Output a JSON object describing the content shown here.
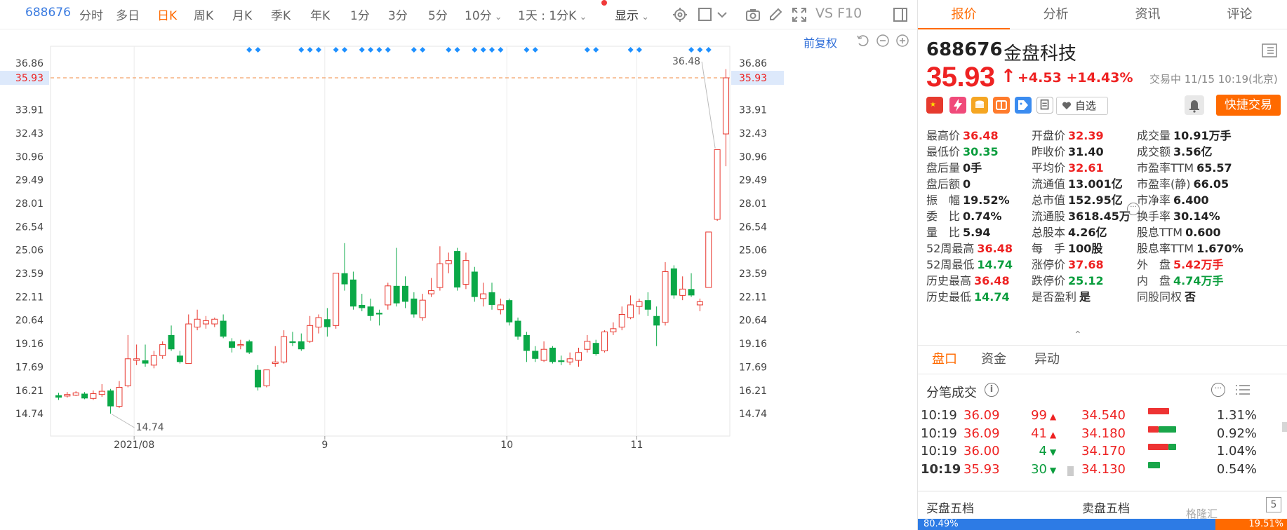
{
  "toolbar": {
    "code": "688676",
    "periods": [
      "分时",
      "多日",
      "日K",
      "周K",
      "月K",
      "季K",
      "年K",
      "1分",
      "3分",
      "5分",
      "10分"
    ],
    "active_period": "日K",
    "interval_select": "1天 : 1分K",
    "display_select": "显示",
    "f10_label": "VS F10",
    "adjust_label": "前复权"
  },
  "tabs": [
    "报价",
    "分析",
    "资讯",
    "评论"
  ],
  "active_tab": "报价",
  "stock": {
    "code": "688676",
    "name": "金盘科技",
    "price": "35.93",
    "change": "+4.53",
    "change_pct": "+14.43%",
    "status": "交易中 11/15 10:19(北京)",
    "watch_label": "自选",
    "quick_trade": "快捷交易"
  },
  "stats": [
    [
      {
        "label": "最高价",
        "value": "36.48",
        "color": "red"
      },
      {
        "label": "开盘价",
        "value": "32.39",
        "color": "red"
      },
      {
        "label": "成交量",
        "value": "10.91万手",
        "color": "black"
      }
    ],
    [
      {
        "label": "最低价",
        "value": "30.35",
        "color": "green"
      },
      {
        "label": "昨收价",
        "value": "31.40",
        "color": "black"
      },
      {
        "label": "成交额",
        "value": "3.56亿",
        "color": "black"
      }
    ],
    [
      {
        "label": "盘后量",
        "value": "0手",
        "color": "black"
      },
      {
        "label": "平均价",
        "value": "32.61",
        "color": "red"
      },
      {
        "label": "市盈率TTM",
        "value": "65.57",
        "color": "black"
      }
    ],
    [
      {
        "label": "盘后额",
        "value": "0",
        "color": "black"
      },
      {
        "label": "流通值",
        "value": "13.001亿",
        "color": "black"
      },
      {
        "label": "市盈率(静)",
        "value": "66.05",
        "color": "black"
      }
    ],
    [
      {
        "label": "振　幅",
        "value": "19.52%",
        "color": "black"
      },
      {
        "label": "总市值",
        "value": "152.95亿",
        "color": "black"
      },
      {
        "label": "市净率",
        "value": "6.400",
        "color": "black"
      }
    ],
    [
      {
        "label": "委　比",
        "value": "0.74%",
        "color": "black"
      },
      {
        "label": "流通股",
        "value": "3618.45万",
        "color": "black"
      },
      {
        "label": "换手率",
        "value": "30.14%",
        "color": "black"
      }
    ],
    [
      {
        "label": "量　比",
        "value": "5.94",
        "color": "black"
      },
      {
        "label": "总股本",
        "value": "4.26亿",
        "color": "black"
      },
      {
        "label": "股息TTM",
        "value": "0.600",
        "color": "black"
      }
    ],
    [
      {
        "label": "52周最高",
        "value": "36.48",
        "color": "red"
      },
      {
        "label": "每　手",
        "value": "100股",
        "color": "black"
      },
      {
        "label": "股息率TTM",
        "value": "1.670%",
        "color": "black"
      }
    ],
    [
      {
        "label": "52周最低",
        "value": "14.74",
        "color": "green"
      },
      {
        "label": "涨停价",
        "value": "37.68",
        "color": "red"
      },
      {
        "label": "外　盘",
        "value": "5.42万手",
        "color": "red"
      }
    ],
    [
      {
        "label": "历史最高",
        "value": "36.48",
        "color": "red"
      },
      {
        "label": "跌停价",
        "value": "25.12",
        "color": "green"
      },
      {
        "label": "内　盘",
        "value": "4.74万手",
        "color": "green"
      }
    ],
    [
      {
        "label": "历史最低",
        "value": "14.74",
        "color": "green"
      },
      {
        "label": "是否盈利",
        "value": "是",
        "color": "black"
      },
      {
        "label": "同股同权",
        "value": "否",
        "color": "black"
      }
    ]
  ],
  "sub_tabs": [
    "盘口",
    "资金",
    "异动"
  ],
  "active_sub_tab": "盘口",
  "tick_title": "分笔成交",
  "ticks": [
    {
      "time": "10:19",
      "price": "36.09",
      "vol": "99",
      "dir": "up",
      "ref": "34.540",
      "pct": "1.31%",
      "red": 0.75,
      "green": 0.0
    },
    {
      "time": "10:19",
      "price": "36.09",
      "vol": "41",
      "dir": "up",
      "ref": "34.180",
      "pct": "0.92%",
      "red": 0.38,
      "green": 0.62
    },
    {
      "time": "10:19",
      "price": "36.00",
      "vol": "4",
      "dir": "down",
      "ref": "34.170",
      "pct": "1.04%",
      "red": 0.72,
      "green": 0.28
    },
    {
      "time": "10:19",
      "price": "35.93",
      "vol": "30",
      "dir": "down",
      "ref": "34.130",
      "pct": "0.54%",
      "red": 0.0,
      "green": 0.42
    }
  ],
  "orderbook": {
    "buy_label": "买盘五档",
    "sell_label": "卖盘五档",
    "five_label": "5",
    "buy_ratio": "80.49%",
    "sell_ratio": "19.51%"
  },
  "watermark": "格隆汇",
  "chart_data": {
    "type": "candlestick",
    "y_ticks": [
      "36.86",
      "35.93",
      "33.91",
      "32.43",
      "30.96",
      "29.49",
      "28.01",
      "26.54",
      "25.06",
      "23.59",
      "22.11",
      "20.64",
      "19.16",
      "17.69",
      "16.21",
      "14.74"
    ],
    "ylim": [
      14.74,
      36.86
    ],
    "x_labels": [
      {
        "label": "2021/08",
        "index": 9
      },
      {
        "label": "9",
        "index": 31
      },
      {
        "label": "10",
        "index": 52
      },
      {
        "label": "11",
        "index": 67
      }
    ],
    "current_price": 35.93,
    "high_annotation": {
      "label": "36.48",
      "index": 76
    },
    "low_annotation": {
      "label": "14.74",
      "index": 6
    },
    "event_marker_indices": [
      22,
      23,
      28,
      29,
      30,
      32,
      33,
      35,
      36,
      37,
      38,
      41,
      42,
      45,
      46,
      48,
      49,
      50,
      51,
      54,
      55,
      61,
      62,
      66,
      67,
      73,
      74,
      75
    ],
    "candles": [
      {
        "o": 15.9,
        "c": 15.75,
        "h": 16.05,
        "l": 15.6
      },
      {
        "o": 15.85,
        "c": 15.95,
        "h": 16.1,
        "l": 15.75
      },
      {
        "o": 15.9,
        "c": 16.05,
        "h": 16.15,
        "l": 15.85
      },
      {
        "o": 16.0,
        "c": 15.7,
        "h": 16.1,
        "l": 15.65
      },
      {
        "o": 15.7,
        "c": 16.0,
        "h": 16.2,
        "l": 15.6
      },
      {
        "o": 15.95,
        "c": 16.15,
        "h": 16.6,
        "l": 15.8
      },
      {
        "o": 16.2,
        "c": 15.2,
        "h": 16.3,
        "l": 14.74
      },
      {
        "o": 15.2,
        "c": 16.4,
        "h": 16.8,
        "l": 15.1
      },
      {
        "o": 16.5,
        "c": 18.2,
        "h": 19.7,
        "l": 16.4
      },
      {
        "o": 18.1,
        "c": 18.2,
        "h": 19.1,
        "l": 17.8
      },
      {
        "o": 18.1,
        "c": 17.9,
        "h": 19.1,
        "l": 17.7
      },
      {
        "o": 17.8,
        "c": 18.4,
        "h": 18.7,
        "l": 17.6
      },
      {
        "o": 18.4,
        "c": 19.1,
        "h": 19.3,
        "l": 18.2
      },
      {
        "o": 19.7,
        "c": 18.8,
        "h": 20.3,
        "l": 18.7
      },
      {
        "o": 18.4,
        "c": 18.0,
        "h": 18.7,
        "l": 17.9
      },
      {
        "o": 17.9,
        "c": 20.4,
        "h": 21.0,
        "l": 17.9
      },
      {
        "o": 20.2,
        "c": 20.7,
        "h": 21.3,
        "l": 20.0
      },
      {
        "o": 20.4,
        "c": 20.6,
        "h": 20.9,
        "l": 20.1
      },
      {
        "o": 20.4,
        "c": 20.7,
        "h": 20.8,
        "l": 20.2
      },
      {
        "o": 20.6,
        "c": 19.6,
        "h": 21.0,
        "l": 19.5
      },
      {
        "o": 19.3,
        "c": 18.9,
        "h": 19.5,
        "l": 18.6
      },
      {
        "o": 19.1,
        "c": 19.1,
        "h": 19.4,
        "l": 18.8
      },
      {
        "o": 19.3,
        "c": 18.6,
        "h": 19.4,
        "l": 18.5
      },
      {
        "o": 17.5,
        "c": 16.4,
        "h": 17.8,
        "l": 16.2
      },
      {
        "o": 16.5,
        "c": 17.5,
        "h": 17.5,
        "l": 16.4
      },
      {
        "o": 17.9,
        "c": 18.0,
        "h": 19.0,
        "l": 17.7
      },
      {
        "o": 18.0,
        "c": 19.6,
        "h": 20.0,
        "l": 17.9
      },
      {
        "o": 19.3,
        "c": 19.2,
        "h": 19.9,
        "l": 19.0
      },
      {
        "o": 19.3,
        "c": 18.8,
        "h": 19.8,
        "l": 18.7
      },
      {
        "o": 19.3,
        "c": 20.3,
        "h": 20.9,
        "l": 19.2
      },
      {
        "o": 20.2,
        "c": 20.8,
        "h": 21.0,
        "l": 19.8
      },
      {
        "o": 20.7,
        "c": 20.2,
        "h": 21.4,
        "l": 19.6
      },
      {
        "o": 20.3,
        "c": 23.6,
        "h": 23.6,
        "l": 20.1
      },
      {
        "o": 23.6,
        "c": 22.9,
        "h": 25.5,
        "l": 22.5
      },
      {
        "o": 23.2,
        "c": 21.5,
        "h": 23.7,
        "l": 21.3
      },
      {
        "o": 21.6,
        "c": 21.4,
        "h": 22.3,
        "l": 21.2
      },
      {
        "o": 21.5,
        "c": 20.9,
        "h": 22.0,
        "l": 20.6
      },
      {
        "o": 21.1,
        "c": 21.0,
        "h": 21.3,
        "l": 20.3
      },
      {
        "o": 21.6,
        "c": 22.8,
        "h": 23.0,
        "l": 21.3
      },
      {
        "o": 22.8,
        "c": 21.7,
        "h": 25.2,
        "l": 21.5
      },
      {
        "o": 22.8,
        "c": 21.8,
        "h": 23.4,
        "l": 21.4
      },
      {
        "o": 22.0,
        "c": 21.0,
        "h": 22.4,
        "l": 20.8
      },
      {
        "o": 20.8,
        "c": 21.9,
        "h": 22.3,
        "l": 20.6
      },
      {
        "o": 22.3,
        "c": 22.5,
        "h": 23.3,
        "l": 22.1
      },
      {
        "o": 22.7,
        "c": 24.2,
        "h": 25.3,
        "l": 22.5
      },
      {
        "o": 24.2,
        "c": 24.4,
        "h": 24.9,
        "l": 23.6
      },
      {
        "o": 25.0,
        "c": 22.7,
        "h": 25.2,
        "l": 22.5
      },
      {
        "o": 22.9,
        "c": 24.4,
        "h": 24.9,
        "l": 22.6
      },
      {
        "o": 23.7,
        "c": 22.1,
        "h": 24.0,
        "l": 21.8
      },
      {
        "o": 22.0,
        "c": 22.3,
        "h": 23.0,
        "l": 21.5
      },
      {
        "o": 22.4,
        "c": 21.6,
        "h": 23.0,
        "l": 21.3
      },
      {
        "o": 21.3,
        "c": 21.6,
        "h": 22.0,
        "l": 21.0
      },
      {
        "o": 21.9,
        "c": 20.5,
        "h": 22.0,
        "l": 20.3
      },
      {
        "o": 20.6,
        "c": 19.6,
        "h": 20.8,
        "l": 19.4
      },
      {
        "o": 19.7,
        "c": 18.7,
        "h": 19.9,
        "l": 18.0
      },
      {
        "o": 18.7,
        "c": 18.2,
        "h": 19.0,
        "l": 18.0
      },
      {
        "o": 18.1,
        "c": 18.8,
        "h": 19.3,
        "l": 18.0
      },
      {
        "o": 18.9,
        "c": 18.0,
        "h": 19.0,
        "l": 17.9
      },
      {
        "o": 18.1,
        "c": 18.0,
        "h": 18.4,
        "l": 17.8
      },
      {
        "o": 18.0,
        "c": 18.2,
        "h": 18.6,
        "l": 17.8
      },
      {
        "o": 18.1,
        "c": 18.6,
        "h": 18.9,
        "l": 17.7
      },
      {
        "o": 18.8,
        "c": 19.3,
        "h": 19.7,
        "l": 18.6
      },
      {
        "o": 19.2,
        "c": 18.5,
        "h": 19.4,
        "l": 18.4
      },
      {
        "o": 18.7,
        "c": 19.9,
        "h": 20.0,
        "l": 18.6
      },
      {
        "o": 19.9,
        "c": 20.1,
        "h": 20.5,
        "l": 19.7
      },
      {
        "o": 20.2,
        "c": 21.0,
        "h": 21.5,
        "l": 20.0
      },
      {
        "o": 20.8,
        "c": 21.6,
        "h": 22.2,
        "l": 20.7
      },
      {
        "o": 21.5,
        "c": 21.8,
        "h": 22.0,
        "l": 21.0
      },
      {
        "o": 21.9,
        "c": 21.3,
        "h": 22.4,
        "l": 20.9
      },
      {
        "o": 20.9,
        "c": 20.3,
        "h": 21.5,
        "l": 19.0
      },
      {
        "o": 20.5,
        "c": 23.7,
        "h": 24.3,
        "l": 20.3
      },
      {
        "o": 23.9,
        "c": 22.2,
        "h": 24.1,
        "l": 22.0
      },
      {
        "o": 22.2,
        "c": 22.6,
        "h": 23.4,
        "l": 21.9
      },
      {
        "o": 22.6,
        "c": 22.2,
        "h": 23.6,
        "l": 22.1
      },
      {
        "o": 21.6,
        "c": 21.8,
        "h": 22.0,
        "l": 21.2
      },
      {
        "o": 22.7,
        "c": 26.2,
        "h": 26.2,
        "l": 22.7
      },
      {
        "o": 27.0,
        "c": 31.4,
        "h": 31.4,
        "l": 26.9
      },
      {
        "o": 32.39,
        "c": 35.93,
        "h": 36.48,
        "l": 30.35
      }
    ]
  }
}
